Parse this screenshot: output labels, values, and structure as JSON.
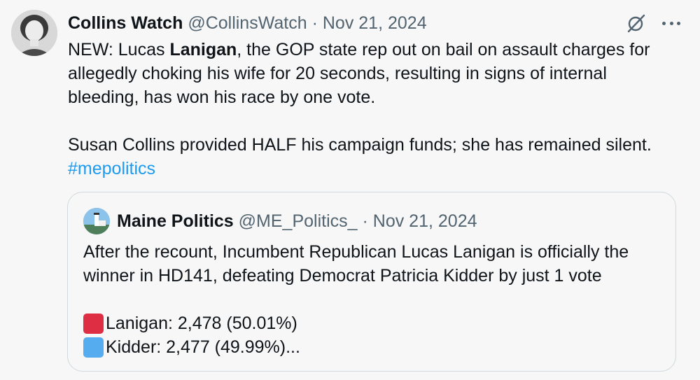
{
  "tweet": {
    "author_name": "Collins Watch",
    "handle": "@CollinsWatch",
    "separator": "·",
    "date": "Nov 21, 2024",
    "body": {
      "line1_pre": "NEW: Lucas ",
      "line1_bold": "Lanigan",
      "line1_post": ", the GOP state rep out on bail on assault charges for",
      "line2": "allegedly choking his wife for 20 seconds, resulting in signs of internal",
      "line3": "bleeding, has won his race by one vote.",
      "line4": "Susan Collins provided HALF his campaign funds; she has remained silent.",
      "hashtag": "#mepolitics"
    },
    "actions": {
      "grok_icon": "grok-icon",
      "more_icon": "more-icon"
    }
  },
  "quote": {
    "author_name": "Maine Politics",
    "handle": "@ME_Politics_",
    "separator": "·",
    "date": "Nov 21, 2024",
    "line1": "After the recount, Incumbent Republican Lucas Lanigan is officially the",
    "line2": "winner in HD141, defeating Democrat Patricia Kidder by just 1 vote",
    "results": [
      {
        "color": "#dd2e44",
        "text": "Lanigan: 2,478 (50.01%)"
      },
      {
        "color": "#55acee",
        "text": "Kidder: 2,477 (49.99%)..."
      }
    ]
  },
  "colors": {
    "background": "#f7f7f7",
    "text": "#0f1419",
    "secondary": "#536471",
    "link": "#1d9bf0",
    "border": "#cfd9de"
  }
}
